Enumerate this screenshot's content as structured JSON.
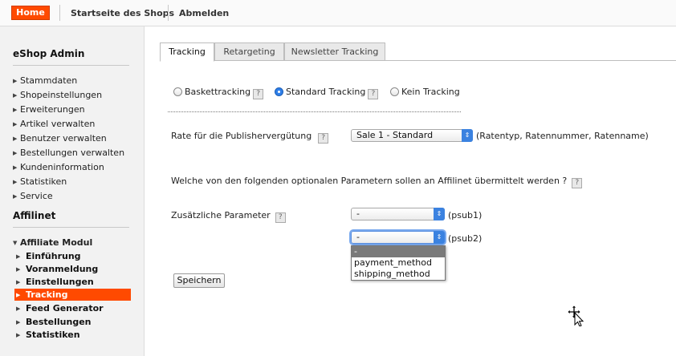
{
  "topbar": {
    "home_label": "Home",
    "links": [
      "Startseite des Shops",
      "Abmelden"
    ]
  },
  "sidebar": {
    "title": "eShop Admin",
    "items": [
      "Stammdaten",
      "Shopeinstellungen",
      "Erweiterungen",
      "Artikel verwalten",
      "Benutzer verwalten",
      "Bestellungen verwalten",
      "Kundeninformation",
      "Statistiken",
      "Service"
    ],
    "section_title": "Affilinet",
    "module_label": "Affiliate Modul",
    "sub_items": [
      "Einführung",
      "Voranmeldung",
      "Einstellungen",
      "Tracking",
      "Feed Generator",
      "Bestellungen",
      "Statistiken"
    ],
    "active_sub": "Tracking"
  },
  "tabs": [
    "Tracking",
    "Retargeting",
    "Newsletter Tracking"
  ],
  "tracking_mode": {
    "options": [
      "Baskettracking",
      "Standard Tracking",
      "Kein Tracking"
    ],
    "selected": "Standard Tracking",
    "help_glyph": "?"
  },
  "rate": {
    "label": "Rate für die Publishervergütung",
    "value": "Sale 1 - Standard",
    "hint": "(Ratentyp, Ratennummer, Ratenname)"
  },
  "params": {
    "question": "Welche von den folgenden optionalen Parametern sollen an Affilinet übermittelt werden ?",
    "label": "Zusätzliche Parameter",
    "psub1_value": "-",
    "psub1_suffix": "(psub1)",
    "psub2_value": "-",
    "psub2_suffix": "(psub2)",
    "dropdown_options": [
      "-",
      "payment_method",
      "shipping_method"
    ],
    "dropdown_selected": "-"
  },
  "save_label": "Speichern",
  "colors": {
    "accent": "#ff4a00",
    "select_blue": "#3b82e0"
  },
  "icons": {
    "help": "help-icon",
    "chevron": "chevron-updown-icon",
    "cursor": "move-cursor-icon"
  }
}
